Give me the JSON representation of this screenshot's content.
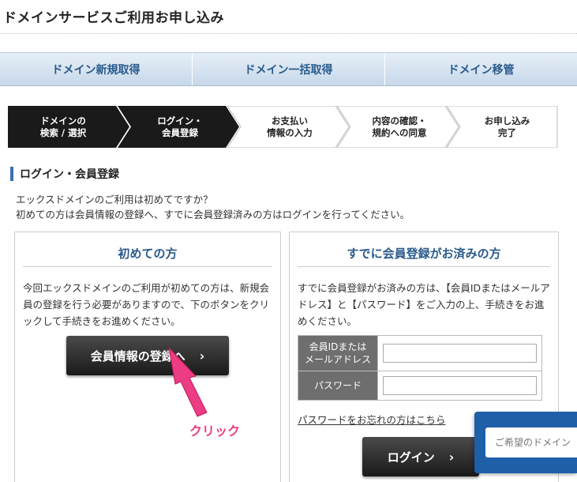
{
  "page_title": "ドメインサービスご利用お申し込み",
  "tabs": [
    {
      "label": "ドメイン新規取得"
    },
    {
      "label": "ドメイン一括取得"
    },
    {
      "label": "ドメイン移管"
    }
  ],
  "steps": [
    {
      "label": "ドメインの\n検索 / 選択",
      "state": "done"
    },
    {
      "label": "ログイン・\n会員登録",
      "state": "current"
    },
    {
      "label": "お支払い\n情報の入力",
      "state": "todo"
    },
    {
      "label": "内容の確認・\n規約への同意",
      "state": "todo"
    },
    {
      "label": "お申し込み\n完了",
      "state": "todo"
    }
  ],
  "section_heading": "ログイン・会員登録",
  "intro": {
    "line1": "エックスドメインのご利用は初めてですか？",
    "line2": "初めての方は会員情報の登録へ、すでに会員登録済みの方はログインを行ってください。"
  },
  "new_user": {
    "title": "初めての方",
    "text": "今回エックスドメインのご利用が初めての方は、新規会員の登録を行う必要がありますので、下のボタンをクリックして手続きをお進めください。",
    "button_label": "会員情報の登録へ",
    "button_chevron": "›"
  },
  "existing_user": {
    "title": "すでに会員登録がお済みの方",
    "text": "すでに会員登録がお済みの方は、【会員IDまたはメールアドレス】と【パスワード】をご入力の上、手続きをお進めください。",
    "id_label": "会員IDまたは\nメールアドレス",
    "id_value": "",
    "password_label": "パスワード",
    "password_value": "",
    "forgot_link": "パスワードをお忘れの方はこちら",
    "login_button": "ログイン",
    "button_chevron": "›"
  },
  "annotation": "クリック",
  "search_widget": {
    "placeholder": "ご希望のドメイン"
  },
  "colors": {
    "accent": "#2a5a8c",
    "active_step": "#1a1a1a",
    "annotation": "#ec3d84",
    "widget": "#1f5fa8"
  }
}
